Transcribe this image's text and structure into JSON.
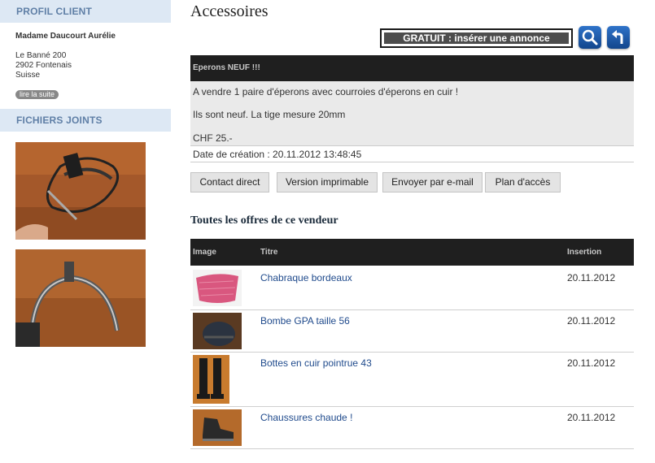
{
  "sidebar": {
    "profil_title": "PROFIL CLIENT",
    "client_name": "Madame Daucourt Aurélie",
    "address": [
      "Le Banné 200",
      "2902 Fontenais",
      "Suisse"
    ],
    "read_more": "lire la suite",
    "files_title": "FICHIERS JOINTS"
  },
  "page": {
    "title": "Accessoires",
    "free_ad_button": "GRATUIT : insérer une annonce",
    "search_icon": "search-icon",
    "back_icon": "back-arrow-icon"
  },
  "ad": {
    "heading": "Eperons NEUF !!!",
    "lines": [
      "A vendre 1 paire d'éperons avec courroies d'éperons en cuir !",
      "Ils sont neuf. La tige mesure 20mm",
      "CHF 25.-"
    ],
    "created": "Date de création : 20.11.2012 13:48:45"
  },
  "actions": [
    "Contact direct",
    "Version imprimable",
    "Envoyer par e-mail",
    "Plan d'accès"
  ],
  "offers": {
    "title": "Toutes les offres de ce vendeur",
    "columns": [
      "Image",
      "Titre",
      "Insertion"
    ],
    "rows": [
      {
        "title": "Chabraque bordeaux",
        "date": "20.11.2012"
      },
      {
        "title": "Bombe GPA taille 56",
        "date": "20.11.2012"
      },
      {
        "title": "Bottes en cuir pointrue 43",
        "date": "20.11.2012"
      },
      {
        "title": "Chaussures chaude !",
        "date": "20.11.2012"
      }
    ]
  },
  "colors": {
    "sidebar_header_bg": "#dde8f4",
    "sidebar_header_text": "#5f7fa6",
    "dark_bar": "#1f1f1f",
    "link": "#1f4a8c",
    "icon_button": "#1f5cab"
  }
}
